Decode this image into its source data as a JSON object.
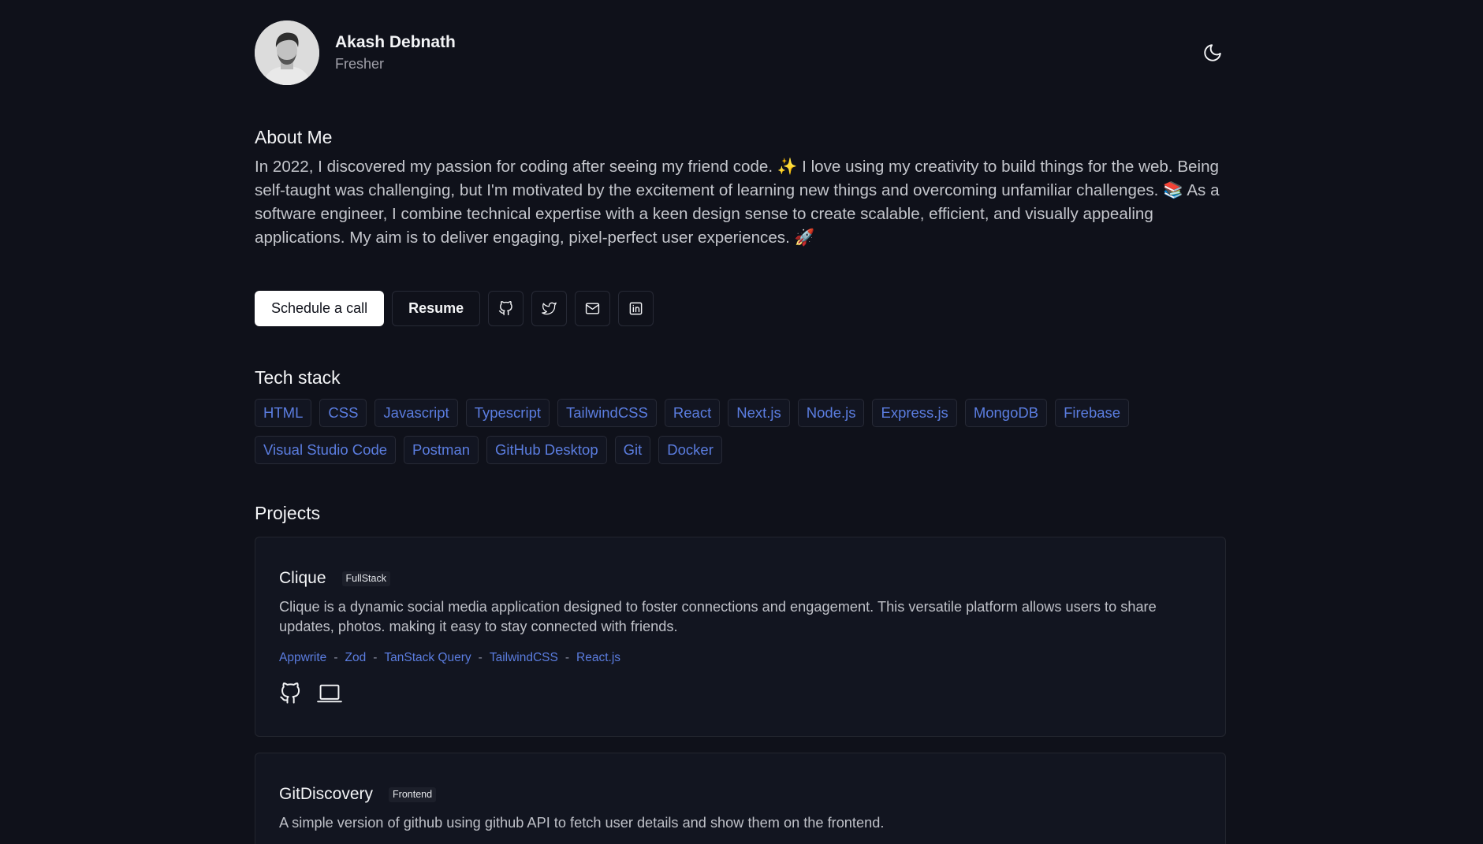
{
  "profile": {
    "name": "Akash Debnath",
    "role": "Fresher"
  },
  "about": {
    "title": "About Me",
    "text": "In 2022, I discovered my passion for coding after seeing my friend code. ✨ I love using my creativity to build things for the web. Being self-taught was challenging, but I'm motivated by the excitement of learning new things and overcoming unfamiliar challenges. 📚 As a software engineer, I combine technical expertise with a keen design sense to create scalable, efficient, and visually appealing applications. My aim is to deliver engaging, pixel-perfect user experiences. 🚀"
  },
  "actions": {
    "schedule_label": "Schedule a call",
    "resume_label": "Resume",
    "icons": [
      "github-icon",
      "twitter-icon",
      "mail-icon",
      "linkedin-icon"
    ]
  },
  "tech": {
    "title": "Tech stack",
    "items": [
      "HTML",
      "CSS",
      "Javascript",
      "Typescript",
      "TailwindCSS",
      "React",
      "Next.js",
      "Node.js",
      "Express.js",
      "MongoDB",
      "Firebase",
      "Visual Studio Code",
      "Postman",
      "GitHub Desktop",
      "Git",
      "Docker"
    ]
  },
  "projects": {
    "title": "Projects",
    "items": [
      {
        "name": "Clique",
        "badge": "FullStack",
        "description": "Clique is a dynamic social media application designed to foster connections and engagement. This versatile platform allows users to share updates, photos. making it easy to stay connected with friends.",
        "tech": [
          "Appwrite",
          "Zod",
          "TanStack Query",
          "TailwindCSS",
          "React.js"
        ],
        "separator": "-"
      },
      {
        "name": "GitDiscovery",
        "badge": "Frontend",
        "description": "A simple version of github using github API to fetch user details and show them on the frontend."
      }
    ]
  },
  "colors": {
    "background": "#0f111a",
    "accent": "#5b7de0",
    "card": "#121520"
  }
}
